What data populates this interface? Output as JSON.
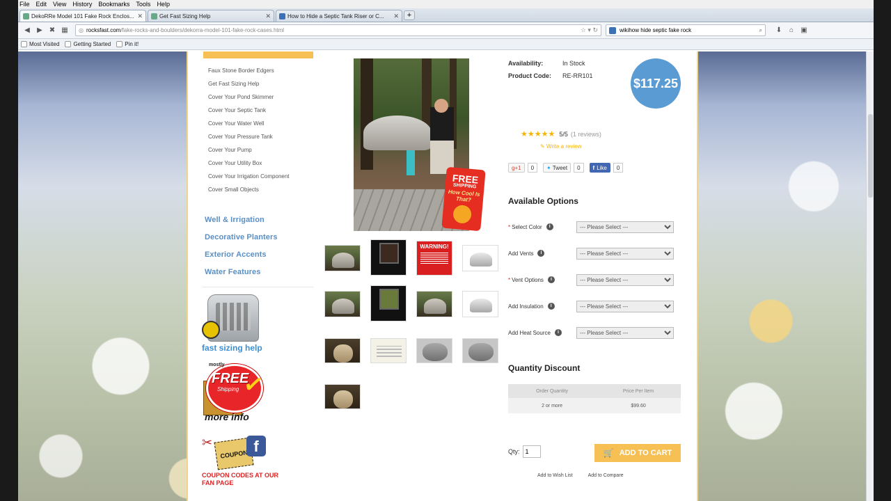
{
  "menu": [
    "File",
    "Edit",
    "View",
    "History",
    "Bookmarks",
    "Tools",
    "Help"
  ],
  "tabs": [
    {
      "title": "DekoRRe Model 101 Fake Rock Enclos...",
      "active": true
    },
    {
      "title": "Get Fast Sizing Help",
      "active": false
    },
    {
      "title": "How to Hide a Septic Tank Riser or C...",
      "active": false
    }
  ],
  "newtab": "+",
  "address": {
    "host": "rocksfast.com",
    "path": "/fake-rocks-and-boulders/dekorra-model-101-fake-rock-cases.html"
  },
  "search": {
    "value": "wikihow hide septic fake rock"
  },
  "bookmarks": [
    "Most Visited",
    "Getting Started",
    "Pin it!"
  ],
  "sidebar": {
    "subitems": [
      "Faux Stone Border Edgers",
      "Get Fast Sizing Help",
      "Cover Your Pond Skimmer",
      "Cover Your Septic Tank",
      "Cover Your Water Well",
      "Cover Your Pressure Tank",
      "Cover Your Pump",
      "Cover Your Utility Box",
      "Cover Your Irrigation Component",
      "Cover Small Objects"
    ],
    "categories": [
      "Well & Irrigation",
      "Decorative Planters",
      "Exterior Accents",
      "Water Features"
    ],
    "sizing_label": "fast sizing help",
    "freeship": {
      "top": "mostly",
      "main": "FREE",
      "sub": "Shipping",
      "bottom": "more info"
    },
    "coupon": {
      "tag": "COUPON",
      "fb": "f",
      "text": "COUPON CODES AT OUR FAN PAGE"
    }
  },
  "freetag": {
    "line1": "FREE",
    "line2": "SHIPPING",
    "line3": "How Cool Is That?"
  },
  "warning_thumb": "WARNING!",
  "product": {
    "availability_label": "Availability:",
    "availability": "In Stock",
    "code_label": "Product Code:",
    "code": "RE-RR101",
    "price": "$117.25",
    "rating": "5/5",
    "reviews": "(1 reviews)",
    "write_review": "✎ Write a review",
    "stars": "★★★★★"
  },
  "social": {
    "gplus": "g+1",
    "gcount": "0",
    "tweet": "Tweet",
    "tcount": "0",
    "like": "Like",
    "lcount": "0"
  },
  "options": {
    "title": "Available Options",
    "rows": [
      {
        "label": "Select Color",
        "required": true,
        "value": "--- Please Select ---"
      },
      {
        "label": "Add Vents",
        "required": false,
        "value": "--- Please Select ---"
      },
      {
        "label": "Vent Options",
        "required": true,
        "value": "--- Please Select ---"
      },
      {
        "label": "Add Insulation",
        "required": false,
        "value": "--- Please Select ---"
      },
      {
        "label": "Add Heat Source",
        "required": false,
        "value": "--- Please Select ---"
      }
    ]
  },
  "discount": {
    "title": "Quantity Discount",
    "headers": [
      "Order Quantity",
      "Price Per Item"
    ],
    "rows": [
      [
        "2 or more",
        "$99.60"
      ]
    ]
  },
  "cart": {
    "qty_label": "Qty:",
    "qty": "1",
    "button": "ADD TO CART",
    "wishlist": "Add to Wish List",
    "compare": "Add to Compare"
  }
}
